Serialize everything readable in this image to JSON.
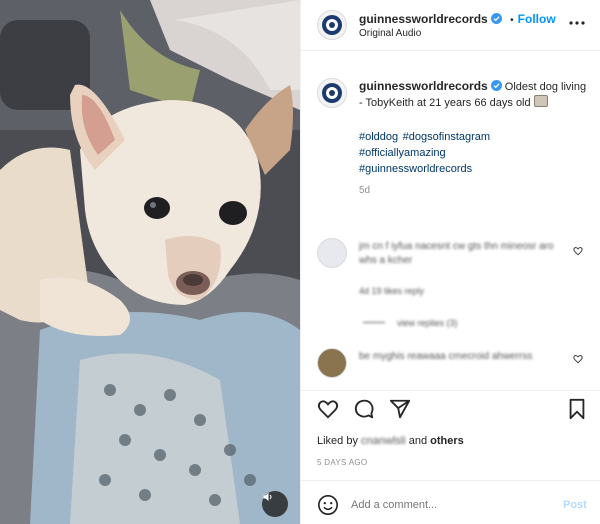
{
  "post": {
    "username": "guinnessworldrecords",
    "audio": "Original Audio",
    "follow_label": "Follow",
    "separator": "•"
  },
  "caption": {
    "username": "guinnessworldrecords",
    "text": "Oldest dog living - TobyKeith at 21 years 66 days old",
    "hashtags": [
      "#olddog",
      "#dogsofinstagram",
      "#officiallyamazing",
      "#guinnessworldrecords"
    ],
    "time": "5d"
  },
  "comments": [
    {
      "text": "jm cn f iyfua nacesnt cw gts thn mineosr aro whs a kcher",
      "meta": "4d 19 likes reply"
    },
    {
      "text": "view replies (3)"
    },
    {
      "text": "be myghis reawaaa cmecroid ahwerrss",
      "meta": ""
    }
  ],
  "likes": {
    "prefix": "Liked by",
    "user": "cnanwlsli",
    "conj": "and",
    "others": "others",
    "date": "5 DAYS AGO"
  },
  "comment_input": {
    "placeholder": "Add a comment...",
    "post_label": "Post"
  },
  "colors": {
    "accent": "#0095f6",
    "verified": "#3897f0",
    "divider": "#efefef"
  },
  "icons": [
    "heart-icon",
    "comment-icon",
    "share-icon",
    "bookmark-icon",
    "more-icon",
    "emoji-icon",
    "speaker-icon",
    "verified-badge-icon",
    "guinness-logo-icon"
  ]
}
